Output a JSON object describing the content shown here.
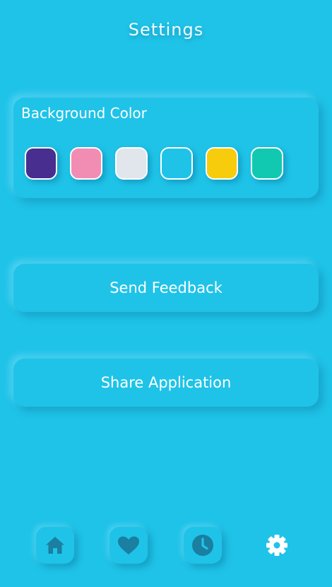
{
  "header": {
    "title": "Settings"
  },
  "background_color": {
    "label": "Background Color",
    "swatches": [
      {
        "name": "purple",
        "color": "#472e8f"
      },
      {
        "name": "pink",
        "color": "#f18db3"
      },
      {
        "name": "light-gray",
        "color": "#e1e5ec"
      },
      {
        "name": "cyan",
        "color": "#1fc3e8"
      },
      {
        "name": "yellow",
        "color": "#f6cc0c"
      },
      {
        "name": "teal",
        "color": "#11c9b0"
      }
    ]
  },
  "actions": {
    "send_feedback": "Send Feedback",
    "share_application": "Share Application"
  },
  "nav": {
    "items": [
      {
        "icon": "home-icon",
        "active": false
      },
      {
        "icon": "heart-icon",
        "active": false
      },
      {
        "icon": "clock-icon",
        "active": false
      },
      {
        "icon": "gear-icon",
        "active": true
      }
    ]
  },
  "colors": {
    "background": "#1fc3e8",
    "icon_inactive": "#1a7fa0",
    "icon_active": "#ffffff"
  }
}
